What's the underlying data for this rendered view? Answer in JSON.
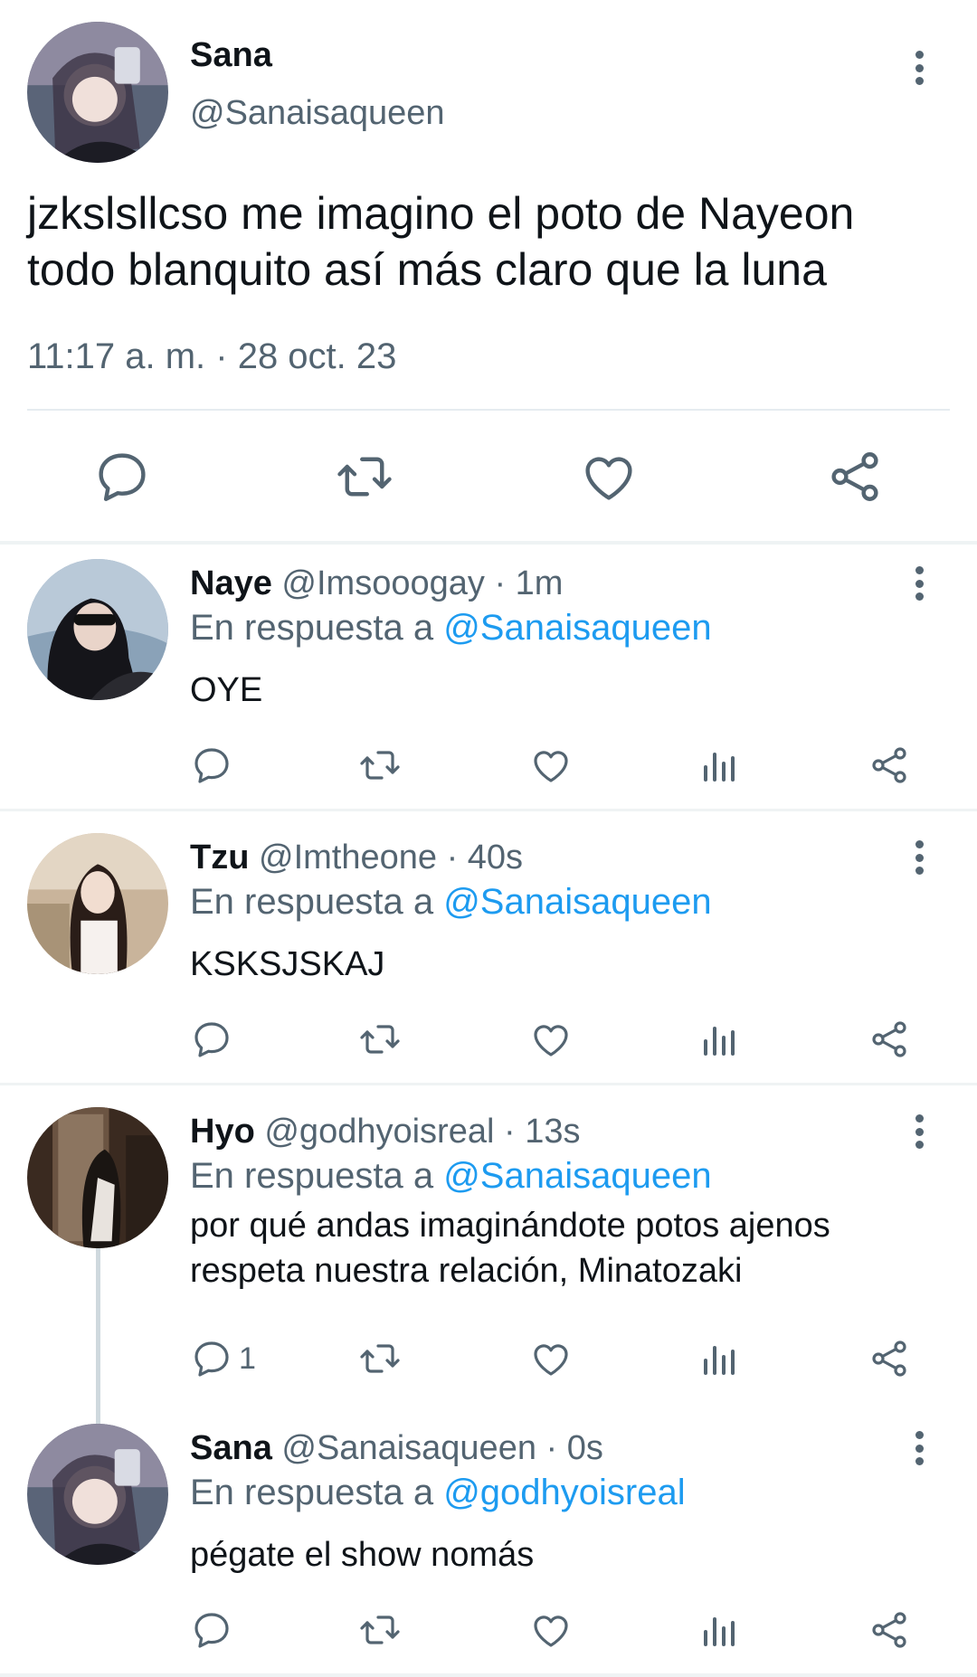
{
  "main_tweet": {
    "author_name": "Sana",
    "author_handle": "@Sanaisaqueen",
    "text": "jzkslsllcso me imagino el poto de Nayeon todo blanquito así más claro que la luna",
    "timestamp": "11:17 a. m. · 28 oct. 23",
    "actions": [
      "reply-icon",
      "retweet-icon",
      "like-icon",
      "share-icon"
    ]
  },
  "replies": [
    {
      "name": "Naye",
      "handle": "@Imsooogay",
      "time": "· 1m",
      "in_reply_prefix": "En respuesta a",
      "in_reply_to": "@Sanaisaqueen",
      "text": "OYE",
      "reply_count": ""
    },
    {
      "name": "Tzu",
      "handle": "@Imtheone",
      "time": "· 40s",
      "in_reply_prefix": "En respuesta a",
      "in_reply_to": "@Sanaisaqueen",
      "text": "KSKSJSKAJ",
      "reply_count": ""
    },
    {
      "name": "Hyo",
      "handle": "@godhyoisreal",
      "time": "· 13s",
      "in_reply_prefix": "En respuesta a",
      "in_reply_to": "@Sanaisaqueen",
      "text": "por qué andas imaginándote potos ajenos respeta nuestra relación, Minatozaki",
      "reply_count": "1"
    },
    {
      "name": "Sana",
      "handle": "@Sanaisaqueen",
      "time": "· 0s",
      "in_reply_prefix": "En respuesta a",
      "in_reply_to": "@godhyoisreal",
      "text": "pégate el show nomás",
      "reply_count": ""
    }
  ],
  "colors": {
    "text_primary": "#0f1419",
    "text_secondary": "#536471",
    "mention": "#1d9bf0",
    "divider": "#e6ecf0"
  }
}
